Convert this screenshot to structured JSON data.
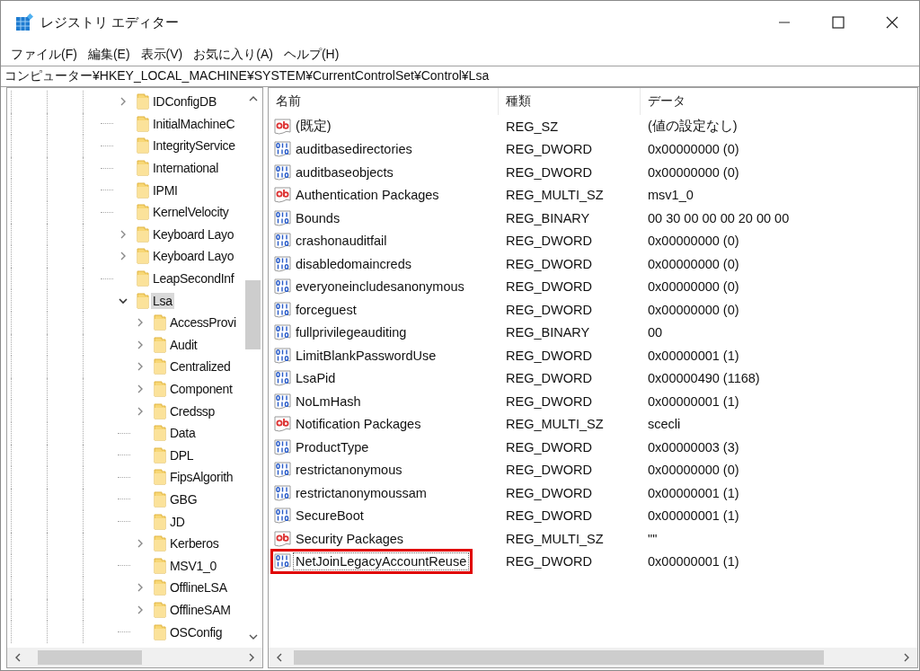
{
  "window": {
    "title": "レジストリ エディター"
  },
  "menu": [
    "ファイル(F)",
    "編集(E)",
    "表示(V)",
    "お気に入り(A)",
    "ヘルプ(H)"
  ],
  "address": "コンピューター¥HKEY_LOCAL_MACHINE¥SYSTEM¥CurrentControlSet¥Control¥Lsa",
  "tree": {
    "items": [
      {
        "label": "IDConfigDB",
        "kind": "branch",
        "expanded": false,
        "selected": false
      },
      {
        "label": "InitialMachineC",
        "kind": "leaf",
        "selected": false
      },
      {
        "label": "IntegrityService",
        "kind": "leaf",
        "selected": false
      },
      {
        "label": "International",
        "kind": "leaf",
        "selected": false
      },
      {
        "label": "IPMI",
        "kind": "leaf",
        "selected": false
      },
      {
        "label": "KernelVelocity",
        "kind": "leaf",
        "selected": false
      },
      {
        "label": "Keyboard Layo",
        "kind": "branch",
        "expanded": false,
        "selected": false
      },
      {
        "label": "Keyboard Layo",
        "kind": "branch",
        "expanded": false,
        "selected": false
      },
      {
        "label": "LeapSecondInf",
        "kind": "leaf",
        "selected": false
      },
      {
        "label": "Lsa",
        "kind": "branch",
        "expanded": true,
        "selected": true,
        "children": [
          {
            "label": "AccessProvi",
            "kind": "branch",
            "expanded": false,
            "selected": false
          },
          {
            "label": "Audit",
            "kind": "branch",
            "expanded": false,
            "selected": false
          },
          {
            "label": "Centralized",
            "kind": "branch",
            "expanded": false,
            "selected": false
          },
          {
            "label": "Component",
            "kind": "branch",
            "expanded": false,
            "selected": false
          },
          {
            "label": "Credssp",
            "kind": "branch",
            "expanded": false,
            "selected": false
          },
          {
            "label": "Data",
            "kind": "leaf",
            "selected": false
          },
          {
            "label": "DPL",
            "kind": "leaf",
            "selected": false
          },
          {
            "label": "FipsAlgorith",
            "kind": "leaf",
            "selected": false
          },
          {
            "label": "GBG",
            "kind": "leaf",
            "selected": false
          },
          {
            "label": "JD",
            "kind": "leaf",
            "selected": false
          },
          {
            "label": "Kerberos",
            "kind": "branch",
            "expanded": false,
            "selected": false
          },
          {
            "label": "MSV1_0",
            "kind": "leaf",
            "selected": false
          },
          {
            "label": "OfflineLSA",
            "kind": "branch",
            "expanded": false,
            "selected": false
          },
          {
            "label": "OfflineSAM",
            "kind": "branch",
            "expanded": false,
            "selected": false
          },
          {
            "label": "OSConfig",
            "kind": "leaf",
            "selected": false
          }
        ]
      }
    ]
  },
  "list": {
    "columns": [
      "名前",
      "種類",
      "データ"
    ],
    "rows": [
      {
        "kind": "string",
        "name": "(既定)",
        "type": "REG_SZ",
        "data": "(値の設定なし)",
        "highlighted": false
      },
      {
        "kind": "binary",
        "name": "auditbasedirectories",
        "type": "REG_DWORD",
        "data": "0x00000000 (0)",
        "highlighted": false
      },
      {
        "kind": "binary",
        "name": "auditbaseobjects",
        "type": "REG_DWORD",
        "data": "0x00000000 (0)",
        "highlighted": false
      },
      {
        "kind": "string",
        "name": "Authentication Packages",
        "type": "REG_MULTI_SZ",
        "data": "msv1_0",
        "highlighted": false
      },
      {
        "kind": "binary",
        "name": "Bounds",
        "type": "REG_BINARY",
        "data": "00 30 00 00 00 20 00 00",
        "highlighted": false
      },
      {
        "kind": "binary",
        "name": "crashonauditfail",
        "type": "REG_DWORD",
        "data": "0x00000000 (0)",
        "highlighted": false
      },
      {
        "kind": "binary",
        "name": "disabledomaincreds",
        "type": "REG_DWORD",
        "data": "0x00000000 (0)",
        "highlighted": false
      },
      {
        "kind": "binary",
        "name": "everyoneincludesanonymous",
        "type": "REG_DWORD",
        "data": "0x00000000 (0)",
        "highlighted": false
      },
      {
        "kind": "binary",
        "name": "forceguest",
        "type": "REG_DWORD",
        "data": "0x00000000 (0)",
        "highlighted": false
      },
      {
        "kind": "binary",
        "name": "fullprivilegeauditing",
        "type": "REG_BINARY",
        "data": "00",
        "highlighted": false
      },
      {
        "kind": "binary",
        "name": "LimitBlankPasswordUse",
        "type": "REG_DWORD",
        "data": "0x00000001 (1)",
        "highlighted": false
      },
      {
        "kind": "binary",
        "name": "LsaPid",
        "type": "REG_DWORD",
        "data": "0x00000490 (1168)",
        "highlighted": false
      },
      {
        "kind": "binary",
        "name": "NoLmHash",
        "type": "REG_DWORD",
        "data": "0x00000001 (1)",
        "highlighted": false
      },
      {
        "kind": "string",
        "name": "Notification Packages",
        "type": "REG_MULTI_SZ",
        "data": "scecli",
        "highlighted": false
      },
      {
        "kind": "binary",
        "name": "ProductType",
        "type": "REG_DWORD",
        "data": "0x00000003 (3)",
        "highlighted": false
      },
      {
        "kind": "binary",
        "name": "restrictanonymous",
        "type": "REG_DWORD",
        "data": "0x00000000 (0)",
        "highlighted": false
      },
      {
        "kind": "binary",
        "name": "restrictanonymoussam",
        "type": "REG_DWORD",
        "data": "0x00000001 (1)",
        "highlighted": false
      },
      {
        "kind": "binary",
        "name": "SecureBoot",
        "type": "REG_DWORD",
        "data": "0x00000001 (1)",
        "highlighted": false
      },
      {
        "kind": "string",
        "name": "Security Packages",
        "type": "REG_MULTI_SZ",
        "data": "\"\"",
        "highlighted": false
      },
      {
        "kind": "binary",
        "name": "NetJoinLegacyAccountReuse",
        "type": "REG_DWORD",
        "data": "0x00000001 (1)",
        "highlighted": true
      }
    ]
  }
}
